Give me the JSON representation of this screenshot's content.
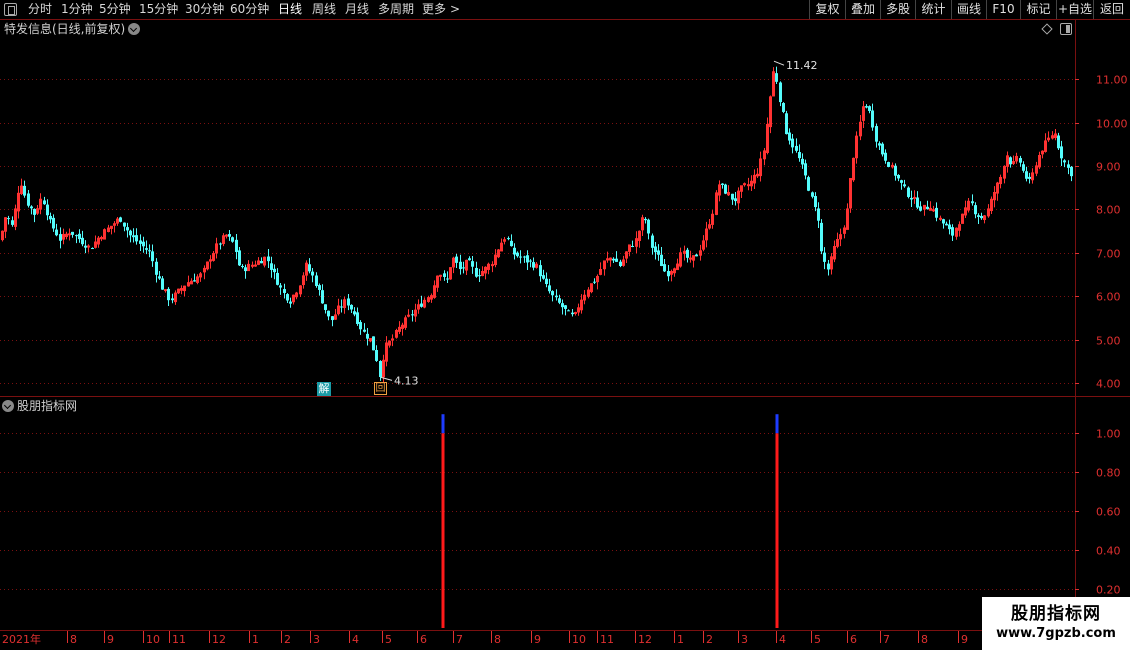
{
  "toolbar": {
    "periods": [
      "分时",
      "1分钟",
      "5分钟",
      "15分钟",
      "30分钟",
      "60分钟",
      "日线",
      "周线",
      "月线",
      "多周期",
      "更多"
    ],
    "more_arrow": ">",
    "active_period": "日线",
    "right_buttons": [
      "复权",
      "叠加",
      "多股",
      "统计",
      "画线",
      "F10",
      "标记",
      "+自选",
      "返回"
    ]
  },
  "main_panel": {
    "title": "特发信息(日线,前复权)",
    "high_label": "11.42",
    "low_label": "4.13",
    "badge_jie": "解",
    "badge_hui": "回"
  },
  "indicator_panel": {
    "title": "股朋指标网"
  },
  "watermark": {
    "title": "股朋指标网",
    "url": "www.7gpzb.com"
  },
  "colors": {
    "up": "#ff3232",
    "down": "#54fcfc",
    "grid": "#7a1010",
    "axis_text": "#e03030",
    "signal_red": "#ff1a1a",
    "signal_blue": "#1e3cff"
  },
  "chart_data": [
    {
      "type": "candlestick",
      "title": "特发信息(日线,前复权)",
      "y_ticks": [
        4.0,
        5.0,
        6.0,
        7.0,
        8.0,
        9.0,
        10.0,
        11.0
      ],
      "ylim": [
        3.7,
        12.0
      ],
      "x_labels": [
        "2021年",
        "8",
        "9",
        "10",
        "11",
        "12",
        "1",
        "2",
        "3",
        "4",
        "5",
        "6",
        "7",
        "8",
        "9",
        "10",
        "11",
        "12",
        "1",
        "2",
        "3",
        "4",
        "5",
        "6",
        "7",
        "8",
        "9"
      ],
      "annotations": [
        {
          "text": "11.42",
          "value": 11.42,
          "kind": "high"
        },
        {
          "text": "4.13",
          "value": 4.13,
          "kind": "low"
        }
      ],
      "close_path": [
        [
          0,
          7.3
        ],
        [
          6,
          7.9
        ],
        [
          12,
          7.6
        ],
        [
          20,
          8.7
        ],
        [
          26,
          8.2
        ],
        [
          34,
          7.9
        ],
        [
          42,
          8.3
        ],
        [
          50,
          7.7
        ],
        [
          60,
          7.3
        ],
        [
          70,
          7.5
        ],
        [
          80,
          7.3
        ],
        [
          90,
          7.1
        ],
        [
          100,
          7.4
        ],
        [
          110,
          7.6
        ],
        [
          120,
          7.8
        ],
        [
          130,
          7.4
        ],
        [
          140,
          7.2
        ],
        [
          150,
          7.0
        ],
        [
          155,
          6.6
        ],
        [
          162,
          6.2
        ],
        [
          170,
          5.9
        ],
        [
          178,
          6.1
        ],
        [
          186,
          6.3
        ],
        [
          194,
          6.4
        ],
        [
          202,
          6.5
        ],
        [
          210,
          6.9
        ],
        [
          218,
          7.2
        ],
        [
          226,
          7.4
        ],
        [
          234,
          7.2
        ],
        [
          240,
          6.6
        ],
        [
          250,
          6.7
        ],
        [
          258,
          6.8
        ],
        [
          266,
          6.9
        ],
        [
          274,
          6.5
        ],
        [
          282,
          6.1
        ],
        [
          290,
          5.9
        ],
        [
          298,
          6.2
        ],
        [
          306,
          6.7
        ],
        [
          314,
          6.4
        ],
        [
          322,
          5.9
        ],
        [
          330,
          5.4
        ],
        [
          338,
          5.7
        ],
        [
          346,
          5.9
        ],
        [
          354,
          5.6
        ],
        [
          362,
          5.2
        ],
        [
          370,
          5.0
        ],
        [
          376,
          4.6
        ],
        [
          380,
          4.13
        ],
        [
          384,
          4.8
        ],
        [
          392,
          5.0
        ],
        [
          400,
          5.3
        ],
        [
          408,
          5.5
        ],
        [
          416,
          5.7
        ],
        [
          424,
          5.9
        ],
        [
          432,
          6.1
        ],
        [
          438,
          6.6
        ],
        [
          446,
          6.3
        ],
        [
          452,
          6.9
        ],
        [
          460,
          6.6
        ],
        [
          468,
          6.8
        ],
        [
          476,
          6.5
        ],
        [
          484,
          6.6
        ],
        [
          492,
          6.8
        ],
        [
          500,
          7.2
        ],
        [
          506,
          7.4
        ],
        [
          512,
          7.0
        ],
        [
          520,
          6.9
        ],
        [
          528,
          6.8
        ],
        [
          536,
          6.7
        ],
        [
          544,
          6.3
        ],
        [
          552,
          6.0
        ],
        [
          560,
          5.8
        ],
        [
          568,
          5.6
        ],
        [
          574,
          5.5
        ],
        [
          580,
          5.9
        ],
        [
          588,
          6.2
        ],
        [
          596,
          6.4
        ],
        [
          604,
          6.8
        ],
        [
          612,
          6.9
        ],
        [
          620,
          6.7
        ],
        [
          628,
          7.1
        ],
        [
          636,
          7.3
        ],
        [
          644,
          7.9
        ],
        [
          650,
          7.2
        ],
        [
          658,
          6.9
        ],
        [
          666,
          6.5
        ],
        [
          674,
          6.7
        ],
        [
          682,
          7.0
        ],
        [
          690,
          6.8
        ],
        [
          698,
          7.0
        ],
        [
          706,
          7.5
        ],
        [
          712,
          7.9
        ],
        [
          718,
          8.6
        ],
        [
          726,
          8.4
        ],
        [
          734,
          8.2
        ],
        [
          742,
          8.5
        ],
        [
          750,
          8.6
        ],
        [
          758,
          8.9
        ],
        [
          764,
          9.4
        ],
        [
          770,
          10.6
        ],
        [
          774,
          11.3
        ],
        [
          780,
          10.5
        ],
        [
          786,
          9.8
        ],
        [
          792,
          9.5
        ],
        [
          800,
          9.1
        ],
        [
          806,
          8.7
        ],
        [
          812,
          8.2
        ],
        [
          818,
          7.8
        ],
        [
          820,
          7.1
        ],
        [
          824,
          6.8
        ],
        [
          828,
          6.6
        ],
        [
          834,
          7.1
        ],
        [
          840,
          7.4
        ],
        [
          846,
          7.8
        ],
        [
          852,
          9.1
        ],
        [
          858,
          9.8
        ],
        [
          864,
          10.5
        ],
        [
          870,
          10.2
        ],
        [
          876,
          9.6
        ],
        [
          882,
          9.3
        ],
        [
          890,
          9.0
        ],
        [
          898,
          8.7
        ],
        [
          906,
          8.4
        ],
        [
          914,
          8.2
        ],
        [
          922,
          8.0
        ],
        [
          930,
          8.1
        ],
        [
          938,
          7.8
        ],
        [
          946,
          7.6
        ],
        [
          952,
          7.4
        ],
        [
          958,
          7.7
        ],
        [
          964,
          7.9
        ],
        [
          970,
          8.2
        ],
        [
          976,
          7.9
        ],
        [
          982,
          7.8
        ],
        [
          988,
          8.0
        ],
        [
          994,
          8.4
        ],
        [
          1000,
          8.7
        ],
        [
          1006,
          9.3
        ],
        [
          1012,
          9.0
        ],
        [
          1018,
          9.2
        ],
        [
          1024,
          8.8
        ],
        [
          1030,
          8.6
        ],
        [
          1036,
          9.1
        ],
        [
          1042,
          9.4
        ],
        [
          1048,
          9.6
        ],
        [
          1054,
          9.8
        ],
        [
          1060,
          9.3
        ],
        [
          1066,
          9.0
        ],
        [
          1072,
          8.8
        ]
      ]
    },
    {
      "type": "bar",
      "title": "股朋指标网",
      "y_ticks": [
        0.2,
        0.4,
        0.6,
        0.8,
        1.0
      ],
      "ylim": [
        0.0,
        1.15
      ],
      "signals": [
        {
          "x": 443,
          "value": 1.0
        },
        {
          "x": 777,
          "value": 1.0
        }
      ]
    }
  ]
}
